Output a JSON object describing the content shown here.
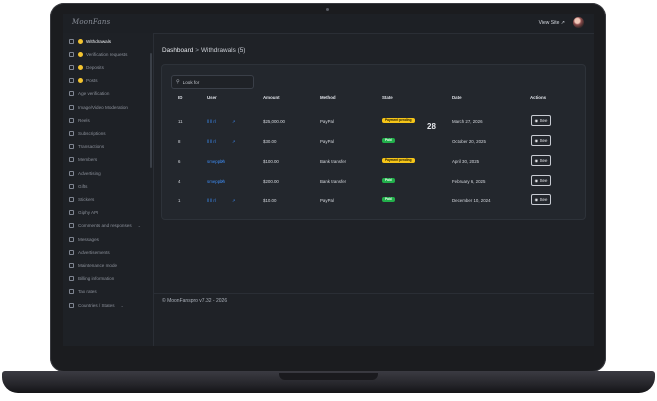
{
  "header": {
    "logo": "MoonFans",
    "view_site": "View Site ↗"
  },
  "sidebar": {
    "items": [
      {
        "label": "Withdrawals",
        "badge": true,
        "active": true
      },
      {
        "label": "Verification requests",
        "badge": true
      },
      {
        "label": "Deposits",
        "badge": true
      },
      {
        "label": "Posts",
        "badge": true
      },
      {
        "label": "Age verification"
      },
      {
        "label": "Image/Video Moderation"
      },
      {
        "label": "Reels"
      },
      {
        "label": "Subscriptions"
      },
      {
        "label": "Transactions"
      },
      {
        "label": "Members"
      },
      {
        "label": "Advertising"
      },
      {
        "label": "Gifts"
      },
      {
        "label": "Stickers"
      },
      {
        "label": "Giphy API"
      },
      {
        "label": "Comments and responses",
        "chevron": true
      },
      {
        "label": "Messages"
      },
      {
        "label": "Advertisements"
      },
      {
        "label": "Maintenance mode"
      },
      {
        "label": "Billing information"
      },
      {
        "label": "Tax rates"
      },
      {
        "label": "Countries / States",
        "chevron": true
      }
    ]
  },
  "breadcrumb": {
    "root": "Dashboard",
    "separator": ">",
    "current": "Withdrawals (5)"
  },
  "search": {
    "placeholder": "Look for"
  },
  "table": {
    "headers": [
      "ID",
      "User",
      "Amount",
      "Method",
      "State",
      "Date",
      "Actions"
    ],
    "rows": [
      {
        "id": "11",
        "user": "ll ll rl",
        "amount": "$25,000.00",
        "method": "PayPal",
        "state": "Payment pending",
        "state_type": "pending",
        "date": "March 27, 2026",
        "action": "See"
      },
      {
        "id": "8",
        "user": "ll ll rl",
        "amount": "$30.00",
        "method": "PayPal",
        "state": "Paid",
        "state_type": "paid",
        "date": "October 20, 2025",
        "action": "See"
      },
      {
        "id": "6",
        "user": "smeppbh",
        "amount": "$100.00",
        "method": "Bank transfer",
        "state": "Payment pending",
        "state_type": "pending",
        "date": "April 30, 2025",
        "action": "See"
      },
      {
        "id": "4",
        "user": "smeppbh",
        "amount": "$200.00",
        "method": "Bank transfer",
        "state": "Paid",
        "state_type": "paid",
        "date": "February 6, 2025",
        "action": "See"
      },
      {
        "id": "1",
        "user": "ll ll rl",
        "amount": "$10.00",
        "method": "PayPal",
        "state": "Paid",
        "state_type": "paid",
        "date": "December 10, 2024",
        "action": "See"
      }
    ]
  },
  "overlay_number": "28",
  "footer": "© MoonFanspro v7.32 - 2026",
  "colors": {
    "accent_link": "#3d8bf2",
    "pending": "#f5c518",
    "paid": "#22b04b",
    "badge": "#f4c430"
  }
}
